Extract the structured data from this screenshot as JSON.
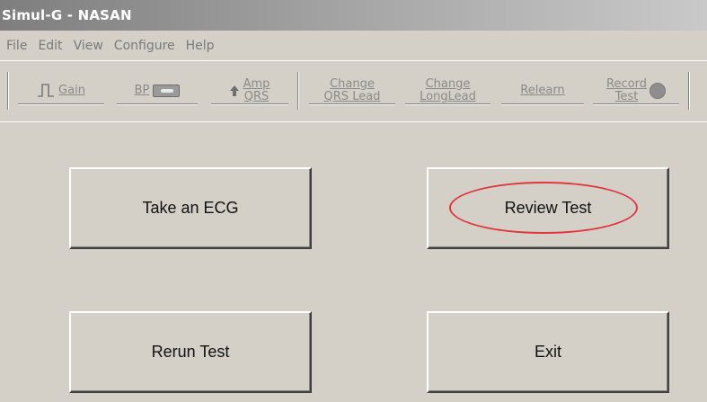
{
  "window": {
    "title": "Simul-G - NASAN"
  },
  "menu": [
    "File",
    "Edit",
    "View",
    "Configure",
    "Help"
  ],
  "toolbar": {
    "gain": "Gain",
    "bp": "BP",
    "amp_qrs": [
      "Amp",
      "QRS"
    ],
    "change_qrs_lead": [
      "Change",
      "QRS Lead"
    ],
    "change_long_lead": [
      "Change",
      "LongLead"
    ],
    "relearn": "Relearn",
    "record_test": [
      "Record",
      "Test"
    ]
  },
  "buttons": {
    "take_ecg": "Take an ECG",
    "review_test": "Review Test",
    "rerun_test": "Rerun Test",
    "exit": "Exit"
  },
  "colors": {
    "background": "#d4d0c8",
    "highlight": "#e0373c",
    "disabled_text": "#8a8a8a"
  }
}
